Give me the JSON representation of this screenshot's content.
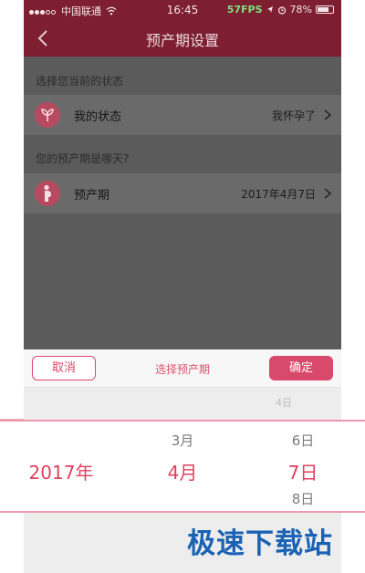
{
  "status_bar": {
    "carrier": "中国联通",
    "time": "16:45",
    "fps": "57FPS",
    "battery": "78%",
    "battery_level": 0.78
  },
  "nav": {
    "title": "预产期设置",
    "back_icon": "chevron-left-icon"
  },
  "sections": [
    {
      "header": "选择您当前的状态",
      "row": {
        "label": "我的状态",
        "value": "我怀孕了",
        "icon": "sprout-icon"
      }
    },
    {
      "header": "您的预产期是哪天?",
      "row": {
        "label": "预产期",
        "value": "2017年4月7日",
        "icon": "pregnant-mother-icon"
      }
    }
  ],
  "sheet": {
    "cancel": "取消",
    "title": "选择预产期",
    "confirm": "确定",
    "faded_above": "4日"
  },
  "picker": {
    "year": {
      "selected": "2017年"
    },
    "month": {
      "above": "3月",
      "selected": "4月"
    },
    "day": {
      "above": "6日",
      "selected": "7日",
      "below": "8日"
    }
  },
  "watermark": "极速下载站",
  "colors": {
    "brand": "#7d1f31",
    "accent": "#d9496b",
    "picker_selected": "#e0405f",
    "watermark": "#1b62b3"
  }
}
